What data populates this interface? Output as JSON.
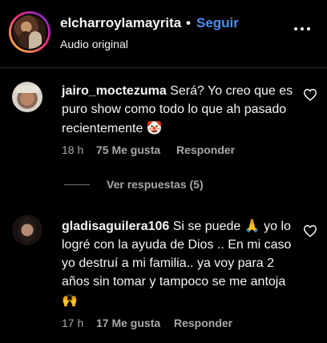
{
  "header": {
    "username": "elcharroylamayrita",
    "separator": "•",
    "follow_label": "Seguir",
    "subtitle": "Audio original",
    "avatar_icon": "profile-avatar",
    "more_icon": "more-horizontal-icon"
  },
  "comments": [
    {
      "username": "jairo_moctezuma",
      "text": "Será? Yo creo que es puro show como todo lo que ah pasado recientemente",
      "emoji": "🤡",
      "time": "18 h",
      "likes": "75 Me gusta",
      "reply_label": "Responder",
      "like_icon": "heart-outline-icon",
      "view_replies": "Ver respuestas (5)"
    },
    {
      "username": "gladisaguilera106",
      "text_before_emoji": "Si se puede",
      "emoji_1": "🙏",
      "text": "yo lo logré con la ayuda de Dios .. En mi caso yo destruí a mi familia.. ya voy para 2 años sin tomar y tampoco se me antoja",
      "emoji_2": "🙌",
      "time": "17 h",
      "likes": "17 Me gusta",
      "reply_label": "Responder",
      "like_icon": "heart-outline-icon"
    }
  ],
  "colors": {
    "background": "#000000",
    "text": "#f5f5f5",
    "secondary": "#a8a8a8",
    "accent": "#4a8df8"
  }
}
